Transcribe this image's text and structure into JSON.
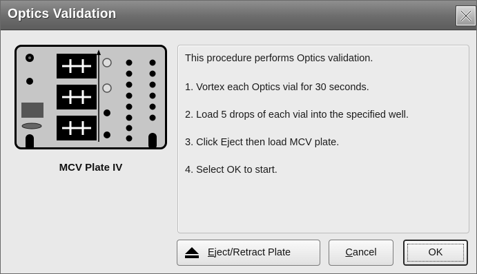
{
  "window": {
    "title": "Optics Validation"
  },
  "plate": {
    "caption": "MCV Plate IV"
  },
  "instructions": [
    "This procedure performs Optics validation.",
    "1. Vortex each Optics vial for 30 seconds.",
    "2. Load 5 drops of each vial into the specified well.",
    "3. Click Eject then load MCV plate.",
    "4. Select OK to start."
  ],
  "buttons": {
    "eject_prefix": "",
    "eject_mnemonic": "E",
    "eject_rest": "ject/Retract Plate",
    "cancel_mnemonic": "C",
    "cancel_rest": "ancel",
    "ok": "OK"
  },
  "icons": {
    "close": "close-icon",
    "eject": "eject-icon"
  },
  "colors": {
    "title_bar": "#6c6c6c",
    "dialog_bg": "#e9e9e9",
    "plate_bg": "#c6c6c6"
  }
}
